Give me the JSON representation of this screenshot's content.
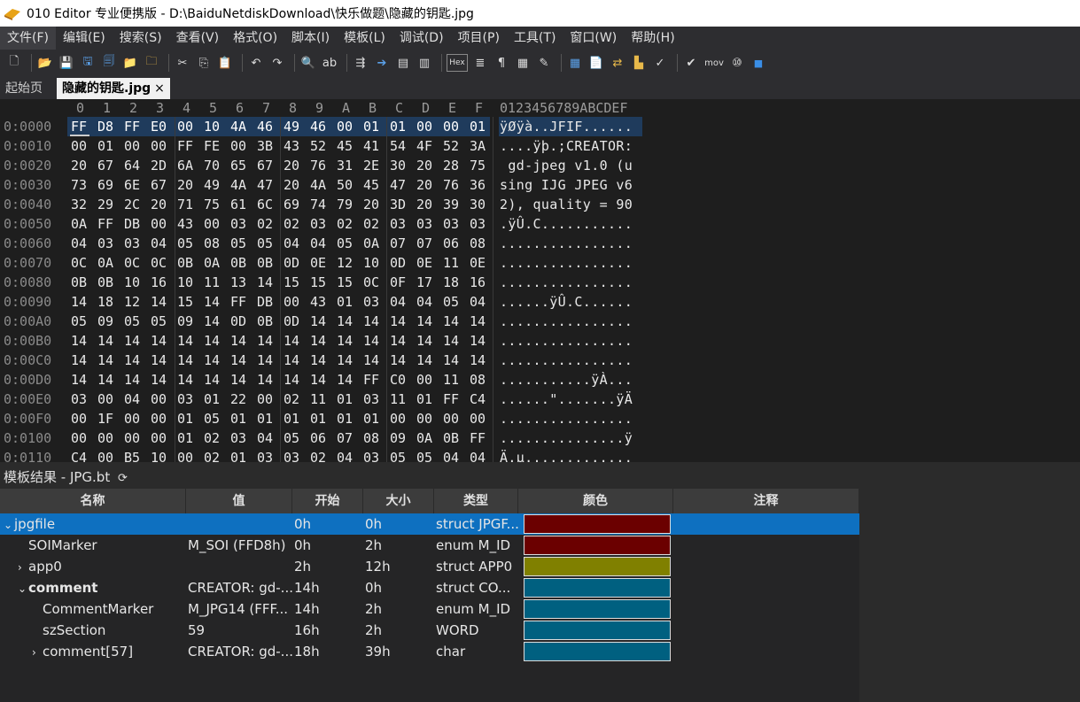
{
  "window": {
    "title": "010 Editor 专业便携版 - D:\\BaiduNetdiskDownload\\快乐做题\\隐藏的钥匙.jpg"
  },
  "menu": [
    "文件(F)",
    "编辑(E)",
    "搜索(S)",
    "查看(V)",
    "格式(O)",
    "脚本(I)",
    "模板(L)",
    "调试(D)",
    "项目(P)",
    "工具(T)",
    "窗口(W)",
    "帮助(H)"
  ],
  "toolbar_icons": [
    "new-file-icon",
    "open-folder-icon",
    "save-icon",
    "save-as-icon",
    "save-all-icon",
    "open-folder-2-icon",
    "open-folder-3-icon",
    "cut-icon",
    "copy-icon",
    "paste-icon",
    "undo-icon",
    "redo-icon",
    "find-icon",
    "find-replace-icon",
    "find-in-files-icon",
    "goto-icon",
    "bookmark-icon",
    "bookmark-2-icon",
    "hex-mode-icon",
    "text-mode-icon",
    "paragraph-icon",
    "columns-icon",
    "highlight-icon",
    "calculator-icon",
    "template-icon",
    "compare-icon",
    "histogram-icon",
    "checksum-icon",
    "run-script-icon",
    "mov-icon",
    "base-convert-icon",
    "stop-icon"
  ],
  "toolbar_hex_label": "Hex",
  "toolbar_mov_label": "mov",
  "tabs": {
    "home": "起始页",
    "file": "隐藏的钥匙.jpg",
    "close": "×"
  },
  "hex": {
    "col_headers": [
      "0",
      "1",
      "2",
      "3",
      "4",
      "5",
      "6",
      "7",
      "8",
      "9",
      "A",
      "B",
      "C",
      "D",
      "E",
      "F"
    ],
    "ascii_header": "0123456789ABCDEF",
    "rows": [
      {
        "addr": "0:0000",
        "bytes": [
          "FF",
          "D8",
          "FF",
          "E0",
          "00",
          "10",
          "4A",
          "46",
          "49",
          "46",
          "00",
          "01",
          "01",
          "00",
          "00",
          "01"
        ],
        "ascii": "ÿØÿà..JFIF......"
      },
      {
        "addr": "0:0010",
        "bytes": [
          "00",
          "01",
          "00",
          "00",
          "FF",
          "FE",
          "00",
          "3B",
          "43",
          "52",
          "45",
          "41",
          "54",
          "4F",
          "52",
          "3A"
        ],
        "ascii": "....ÿþ.;CREATOR:"
      },
      {
        "addr": "0:0020",
        "bytes": [
          "20",
          "67",
          "64",
          "2D",
          "6A",
          "70",
          "65",
          "67",
          "20",
          "76",
          "31",
          "2E",
          "30",
          "20",
          "28",
          "75"
        ],
        "ascii": " gd-jpeg v1.0 (u"
      },
      {
        "addr": "0:0030",
        "bytes": [
          "73",
          "69",
          "6E",
          "67",
          "20",
          "49",
          "4A",
          "47",
          "20",
          "4A",
          "50",
          "45",
          "47",
          "20",
          "76",
          "36"
        ],
        "ascii": "sing IJG JPEG v6"
      },
      {
        "addr": "0:0040",
        "bytes": [
          "32",
          "29",
          "2C",
          "20",
          "71",
          "75",
          "61",
          "6C",
          "69",
          "74",
          "79",
          "20",
          "3D",
          "20",
          "39",
          "30"
        ],
        "ascii": "2), quality = 90"
      },
      {
        "addr": "0:0050",
        "bytes": [
          "0A",
          "FF",
          "DB",
          "00",
          "43",
          "00",
          "03",
          "02",
          "02",
          "03",
          "02",
          "02",
          "03",
          "03",
          "03",
          "03"
        ],
        "ascii": ".ÿÛ.C..........."
      },
      {
        "addr": "0:0060",
        "bytes": [
          "04",
          "03",
          "03",
          "04",
          "05",
          "08",
          "05",
          "05",
          "04",
          "04",
          "05",
          "0A",
          "07",
          "07",
          "06",
          "08"
        ],
        "ascii": "................"
      },
      {
        "addr": "0:0070",
        "bytes": [
          "0C",
          "0A",
          "0C",
          "0C",
          "0B",
          "0A",
          "0B",
          "0B",
          "0D",
          "0E",
          "12",
          "10",
          "0D",
          "0E",
          "11",
          "0E"
        ],
        "ascii": "................"
      },
      {
        "addr": "0:0080",
        "bytes": [
          "0B",
          "0B",
          "10",
          "16",
          "10",
          "11",
          "13",
          "14",
          "15",
          "15",
          "15",
          "0C",
          "0F",
          "17",
          "18",
          "16"
        ],
        "ascii": "................"
      },
      {
        "addr": "0:0090",
        "bytes": [
          "14",
          "18",
          "12",
          "14",
          "15",
          "14",
          "FF",
          "DB",
          "00",
          "43",
          "01",
          "03",
          "04",
          "04",
          "05",
          "04"
        ],
        "ascii": "......ÿÛ.C......"
      },
      {
        "addr": "0:00A0",
        "bytes": [
          "05",
          "09",
          "05",
          "05",
          "09",
          "14",
          "0D",
          "0B",
          "0D",
          "14",
          "14",
          "14",
          "14",
          "14",
          "14",
          "14"
        ],
        "ascii": "................"
      },
      {
        "addr": "0:00B0",
        "bytes": [
          "14",
          "14",
          "14",
          "14",
          "14",
          "14",
          "14",
          "14",
          "14",
          "14",
          "14",
          "14",
          "14",
          "14",
          "14",
          "14"
        ],
        "ascii": "................"
      },
      {
        "addr": "0:00C0",
        "bytes": [
          "14",
          "14",
          "14",
          "14",
          "14",
          "14",
          "14",
          "14",
          "14",
          "14",
          "14",
          "14",
          "14",
          "14",
          "14",
          "14"
        ],
        "ascii": "................"
      },
      {
        "addr": "0:00D0",
        "bytes": [
          "14",
          "14",
          "14",
          "14",
          "14",
          "14",
          "14",
          "14",
          "14",
          "14",
          "14",
          "FF",
          "C0",
          "00",
          "11",
          "08"
        ],
        "ascii": "...........ÿÀ..."
      },
      {
        "addr": "0:00E0",
        "bytes": [
          "03",
          "00",
          "04",
          "00",
          "03",
          "01",
          "22",
          "00",
          "02",
          "11",
          "01",
          "03",
          "11",
          "01",
          "FF",
          "C4"
        ],
        "ascii": "......\".......ÿÄ"
      },
      {
        "addr": "0:00F0",
        "bytes": [
          "00",
          "1F",
          "00",
          "00",
          "01",
          "05",
          "01",
          "01",
          "01",
          "01",
          "01",
          "01",
          "00",
          "00",
          "00",
          "00"
        ],
        "ascii": "................"
      },
      {
        "addr": "0:0100",
        "bytes": [
          "00",
          "00",
          "00",
          "00",
          "01",
          "02",
          "03",
          "04",
          "05",
          "06",
          "07",
          "08",
          "09",
          "0A",
          "0B",
          "FF"
        ],
        "ascii": "...............ÿ"
      },
      {
        "addr": "0:0110",
        "bytes": [
          "C4",
          "00",
          "B5",
          "10",
          "00",
          "02",
          "01",
          "03",
          "03",
          "02",
          "04",
          "03",
          "05",
          "05",
          "04",
          "04"
        ],
        "ascii": "Ä.µ............."
      }
    ]
  },
  "template": {
    "header": "模板结果 - JPG.bt",
    "columns": [
      "名称",
      "值",
      "开始",
      "大小",
      "类型",
      "颜色",
      "注释"
    ],
    "rows": [
      {
        "name": "jpgfile",
        "indent": 0,
        "expand": "v",
        "value": "",
        "start": "0h",
        "size": "0h",
        "type": "struct JPGF...",
        "color": "#6b0000",
        "bold": false,
        "selected": true
      },
      {
        "name": "SOIMarker",
        "indent": 1,
        "expand": "",
        "value": "M_SOI (FFD8h)",
        "start": "0h",
        "size": "2h",
        "type": "enum M_ID",
        "color": "#6b0000",
        "bold": false,
        "selected": false
      },
      {
        "name": "app0",
        "indent": 1,
        "expand": ">",
        "value": "",
        "start": "2h",
        "size": "12h",
        "type": "struct APP0",
        "color": "#808000",
        "bold": false,
        "selected": false
      },
      {
        "name": "comment",
        "indent": 1,
        "expand": "v",
        "value": "CREATOR: gd-...",
        "start": "14h",
        "size": "0h",
        "type": "struct CO...",
        "color": "#006080",
        "bold": true,
        "selected": false
      },
      {
        "name": "CommentMarker",
        "indent": 2,
        "expand": "",
        "value": "M_JPG14 (FFF...",
        "start": "14h",
        "size": "2h",
        "type": "enum M_ID",
        "color": "#006080",
        "bold": false,
        "selected": false
      },
      {
        "name": "szSection",
        "indent": 2,
        "expand": "",
        "value": "59",
        "start": "16h",
        "size": "2h",
        "type": "WORD",
        "color": "#006080",
        "bold": false,
        "selected": false
      },
      {
        "name": "comment[57]",
        "indent": 2,
        "expand": ">",
        "value": "CREATOR: gd-...",
        "start": "18h",
        "size": "39h",
        "type": "char",
        "color": "#006080",
        "bold": false,
        "selected": false
      }
    ]
  }
}
